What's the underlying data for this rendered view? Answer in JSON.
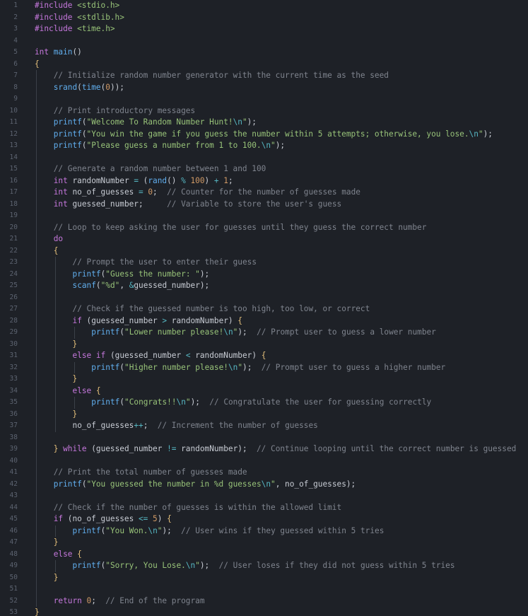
{
  "editor": {
    "language": "c",
    "lines": [
      {
        "n": "1",
        "indent": 0,
        "tokens": [
          [
            "pp",
            "#include"
          ],
          [
            "txt",
            " "
          ],
          [
            "hdr",
            "<stdio.h>"
          ]
        ]
      },
      {
        "n": "2",
        "indent": 0,
        "tokens": [
          [
            "pp",
            "#include"
          ],
          [
            "txt",
            " "
          ],
          [
            "hdr",
            "<stdlib.h>"
          ]
        ]
      },
      {
        "n": "3",
        "indent": 0,
        "tokens": [
          [
            "pp",
            "#include"
          ],
          [
            "txt",
            " "
          ],
          [
            "hdr",
            "<time.h>"
          ]
        ]
      },
      {
        "n": "4",
        "indent": 0,
        "tokens": []
      },
      {
        "n": "5",
        "indent": 0,
        "tokens": [
          [
            "ty",
            "int"
          ],
          [
            "txt",
            " "
          ],
          [
            "fn",
            "main"
          ],
          [
            "txt",
            "()"
          ]
        ]
      },
      {
        "n": "6",
        "indent": 0,
        "tokens": [
          [
            "br",
            "{"
          ]
        ]
      },
      {
        "n": "7",
        "indent": 1,
        "tokens": [
          [
            "cm",
            "// Initialize random number generator with the current time as the seed"
          ]
        ]
      },
      {
        "n": "8",
        "indent": 1,
        "tokens": [
          [
            "fn",
            "srand"
          ],
          [
            "txt",
            "("
          ],
          [
            "fn",
            "time"
          ],
          [
            "txt",
            "("
          ],
          [
            "num",
            "0"
          ],
          [
            "txt",
            "));"
          ]
        ]
      },
      {
        "n": "9",
        "indent": 0,
        "tokens": []
      },
      {
        "n": "10",
        "indent": 1,
        "tokens": [
          [
            "cm",
            "// Print introductory messages"
          ]
        ]
      },
      {
        "n": "11",
        "indent": 1,
        "tokens": [
          [
            "fn",
            "printf"
          ],
          [
            "txt",
            "("
          ],
          [
            "str",
            "\"Welcome To Random Number Hunt!"
          ],
          [
            "esc",
            "\\n"
          ],
          [
            "str",
            "\""
          ],
          [
            "txt",
            ");"
          ]
        ]
      },
      {
        "n": "12",
        "indent": 1,
        "tokens": [
          [
            "fn",
            "printf"
          ],
          [
            "txt",
            "("
          ],
          [
            "str",
            "\"You win the game if you guess the number within 5 attempts; otherwise, you lose."
          ],
          [
            "esc",
            "\\n"
          ],
          [
            "str",
            "\""
          ],
          [
            "txt",
            ");"
          ]
        ]
      },
      {
        "n": "13",
        "indent": 1,
        "tokens": [
          [
            "fn",
            "printf"
          ],
          [
            "txt",
            "("
          ],
          [
            "str",
            "\"Please guess a number from 1 to 100."
          ],
          [
            "esc",
            "\\n"
          ],
          [
            "str",
            "\""
          ],
          [
            "txt",
            ");"
          ]
        ]
      },
      {
        "n": "14",
        "indent": 0,
        "tokens": []
      },
      {
        "n": "15",
        "indent": 1,
        "tokens": [
          [
            "cm",
            "// Generate a random number between 1 and 100"
          ]
        ]
      },
      {
        "n": "16",
        "indent": 1,
        "tokens": [
          [
            "ty",
            "int"
          ],
          [
            "txt",
            " randomNumber "
          ],
          [
            "op",
            "="
          ],
          [
            "txt",
            " ("
          ],
          [
            "fn",
            "rand"
          ],
          [
            "txt",
            "() "
          ],
          [
            "op",
            "%"
          ],
          [
            "txt",
            " "
          ],
          [
            "num",
            "100"
          ],
          [
            "txt",
            ") "
          ],
          [
            "op",
            "+"
          ],
          [
            "txt",
            " "
          ],
          [
            "num",
            "1"
          ],
          [
            "txt",
            ";"
          ]
        ]
      },
      {
        "n": "17",
        "indent": 1,
        "tokens": [
          [
            "ty",
            "int"
          ],
          [
            "txt",
            " no_of_guesses "
          ],
          [
            "op",
            "="
          ],
          [
            "txt",
            " "
          ],
          [
            "num",
            "0"
          ],
          [
            "txt",
            ";  "
          ],
          [
            "cm",
            "// Counter for the number of guesses made"
          ]
        ]
      },
      {
        "n": "18",
        "indent": 1,
        "tokens": [
          [
            "ty",
            "int"
          ],
          [
            "txt",
            " guessed_number;     "
          ],
          [
            "cm",
            "// Variable to store the user's guess"
          ]
        ]
      },
      {
        "n": "19",
        "indent": 0,
        "tokens": []
      },
      {
        "n": "20",
        "indent": 1,
        "tokens": [
          [
            "cm",
            "// Loop to keep asking the user for guesses until they guess the correct number"
          ]
        ]
      },
      {
        "n": "21",
        "indent": 1,
        "tokens": [
          [
            "kw",
            "do"
          ]
        ]
      },
      {
        "n": "22",
        "indent": 1,
        "tokens": [
          [
            "br",
            "{"
          ]
        ]
      },
      {
        "n": "23",
        "indent": 2,
        "tokens": [
          [
            "cm",
            "// Prompt the user to enter their guess"
          ]
        ]
      },
      {
        "n": "24",
        "indent": 2,
        "tokens": [
          [
            "fn",
            "printf"
          ],
          [
            "txt",
            "("
          ],
          [
            "str",
            "\"Guess the number: \""
          ],
          [
            "txt",
            ");"
          ]
        ]
      },
      {
        "n": "25",
        "indent": 2,
        "tokens": [
          [
            "fn",
            "scanf"
          ],
          [
            "txt",
            "("
          ],
          [
            "str",
            "\"%d\""
          ],
          [
            "txt",
            ", "
          ],
          [
            "op",
            "&"
          ],
          [
            "txt",
            "guessed_number);"
          ]
        ]
      },
      {
        "n": "26",
        "indent": 0,
        "tokens": []
      },
      {
        "n": "27",
        "indent": 2,
        "tokens": [
          [
            "cm",
            "// Check if the guessed number is too high, too low, or correct"
          ]
        ]
      },
      {
        "n": "28",
        "indent": 2,
        "tokens": [
          [
            "kw",
            "if"
          ],
          [
            "txt",
            " (guessed_number "
          ],
          [
            "op",
            ">"
          ],
          [
            "txt",
            " randomNumber) "
          ],
          [
            "br",
            "{"
          ]
        ]
      },
      {
        "n": "29",
        "indent": 3,
        "tokens": [
          [
            "fn",
            "printf"
          ],
          [
            "txt",
            "("
          ],
          [
            "str",
            "\"Lower number please!"
          ],
          [
            "esc",
            "\\n"
          ],
          [
            "str",
            "\""
          ],
          [
            "txt",
            ");  "
          ],
          [
            "cm",
            "// Prompt user to guess a lower number"
          ]
        ]
      },
      {
        "n": "30",
        "indent": 2,
        "tokens": [
          [
            "br",
            "}"
          ]
        ]
      },
      {
        "n": "31",
        "indent": 2,
        "tokens": [
          [
            "kw",
            "else if"
          ],
          [
            "txt",
            " (guessed_number "
          ],
          [
            "op",
            "<"
          ],
          [
            "txt",
            " randomNumber) "
          ],
          [
            "br",
            "{"
          ]
        ]
      },
      {
        "n": "32",
        "indent": 3,
        "tokens": [
          [
            "fn",
            "printf"
          ],
          [
            "txt",
            "("
          ],
          [
            "str",
            "\"Higher number please!"
          ],
          [
            "esc",
            "\\n"
          ],
          [
            "str",
            "\""
          ],
          [
            "txt",
            ");  "
          ],
          [
            "cm",
            "// Prompt user to guess a higher number"
          ]
        ]
      },
      {
        "n": "33",
        "indent": 2,
        "tokens": [
          [
            "br",
            "}"
          ]
        ]
      },
      {
        "n": "34",
        "indent": 2,
        "tokens": [
          [
            "kw",
            "else"
          ],
          [
            "txt",
            " "
          ],
          [
            "br",
            "{"
          ]
        ]
      },
      {
        "n": "35",
        "indent": 3,
        "tokens": [
          [
            "fn",
            "printf"
          ],
          [
            "txt",
            "("
          ],
          [
            "str",
            "\"Congrats!!"
          ],
          [
            "esc",
            "\\n"
          ],
          [
            "str",
            "\""
          ],
          [
            "txt",
            ");  "
          ],
          [
            "cm",
            "// Congratulate the user for guessing correctly"
          ]
        ]
      },
      {
        "n": "36",
        "indent": 2,
        "tokens": [
          [
            "br",
            "}"
          ]
        ]
      },
      {
        "n": "37",
        "indent": 2,
        "tokens": [
          [
            "txt",
            "no_of_guesses"
          ],
          [
            "op",
            "++"
          ],
          [
            "txt",
            ";  "
          ],
          [
            "cm",
            "// Increment the number of guesses"
          ]
        ]
      },
      {
        "n": "38",
        "indent": 0,
        "tokens": []
      },
      {
        "n": "39",
        "indent": 1,
        "tokens": [
          [
            "br",
            "}"
          ],
          [
            "txt",
            " "
          ],
          [
            "kw",
            "while"
          ],
          [
            "txt",
            " (guessed_number "
          ],
          [
            "op",
            "!="
          ],
          [
            "txt",
            " randomNumber);  "
          ],
          [
            "cm",
            "// Continue looping until the correct number is guessed"
          ]
        ]
      },
      {
        "n": "40",
        "indent": 0,
        "tokens": []
      },
      {
        "n": "41",
        "indent": 1,
        "tokens": [
          [
            "cm",
            "// Print the total number of guesses made"
          ]
        ]
      },
      {
        "n": "42",
        "indent": 1,
        "tokens": [
          [
            "fn",
            "printf"
          ],
          [
            "txt",
            "("
          ],
          [
            "str",
            "\"You guessed the number in %d guesses"
          ],
          [
            "esc",
            "\\n"
          ],
          [
            "str",
            "\""
          ],
          [
            "txt",
            ", no_of_guesses);"
          ]
        ]
      },
      {
        "n": "43",
        "indent": 0,
        "tokens": []
      },
      {
        "n": "44",
        "indent": 1,
        "tokens": [
          [
            "cm",
            "// Check if the number of guesses is within the allowed limit"
          ]
        ]
      },
      {
        "n": "45",
        "indent": 1,
        "tokens": [
          [
            "kw",
            "if"
          ],
          [
            "txt",
            " (no_of_guesses "
          ],
          [
            "op",
            "<="
          ],
          [
            "txt",
            " "
          ],
          [
            "num",
            "5"
          ],
          [
            "txt",
            ") "
          ],
          [
            "br",
            "{"
          ]
        ]
      },
      {
        "n": "46",
        "indent": 2,
        "tokens": [
          [
            "fn",
            "printf"
          ],
          [
            "txt",
            "("
          ],
          [
            "str",
            "\"You Won."
          ],
          [
            "esc",
            "\\n"
          ],
          [
            "str",
            "\""
          ],
          [
            "txt",
            ");  "
          ],
          [
            "cm",
            "// User wins if they guessed within 5 tries"
          ]
        ]
      },
      {
        "n": "47",
        "indent": 1,
        "tokens": [
          [
            "br",
            "}"
          ]
        ]
      },
      {
        "n": "48",
        "indent": 1,
        "tokens": [
          [
            "kw",
            "else"
          ],
          [
            "txt",
            " "
          ],
          [
            "br",
            "{"
          ]
        ]
      },
      {
        "n": "49",
        "indent": 2,
        "tokens": [
          [
            "fn",
            "printf"
          ],
          [
            "txt",
            "("
          ],
          [
            "str",
            "\"Sorry, You Lose."
          ],
          [
            "esc",
            "\\n"
          ],
          [
            "str",
            "\""
          ],
          [
            "txt",
            ");  "
          ],
          [
            "cm",
            "// User loses if they did not guess within 5 tries"
          ]
        ]
      },
      {
        "n": "50",
        "indent": 1,
        "tokens": [
          [
            "br",
            "}"
          ]
        ]
      },
      {
        "n": "51",
        "indent": 0,
        "tokens": []
      },
      {
        "n": "52",
        "indent": 1,
        "tokens": [
          [
            "kw",
            "return"
          ],
          [
            "txt",
            " "
          ],
          [
            "num",
            "0"
          ],
          [
            "txt",
            ";  "
          ],
          [
            "cm",
            "// End of the program"
          ]
        ]
      },
      {
        "n": "53",
        "indent": 0,
        "tokens": [
          [
            "br",
            "}"
          ]
        ]
      }
    ]
  },
  "colors": {
    "background": "#1e2127",
    "line_number": "#5c6370",
    "keyword": "#c678dd",
    "function": "#61afef",
    "string": "#98c379",
    "number": "#d19a66",
    "operator": "#56b6c2",
    "comment": "#7f848e",
    "text": "#c8ccd4"
  }
}
